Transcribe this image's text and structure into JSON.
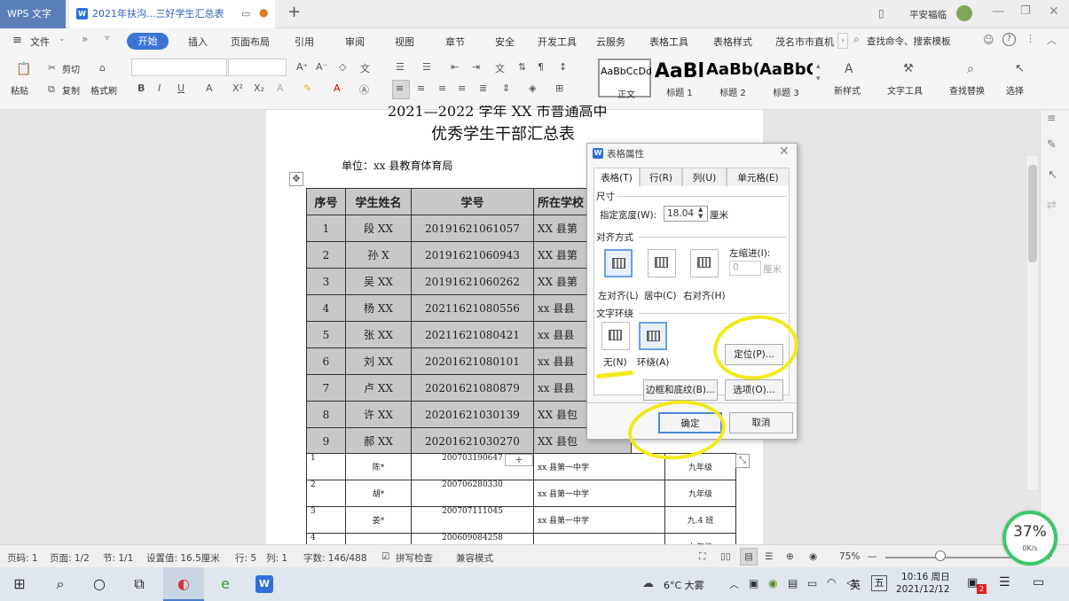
{
  "titlebar": {
    "app_tab": "WPS 文字",
    "doc_tab": "2021年扶沟...三好学生汇总表",
    "user": "平安福临"
  },
  "menubar": {
    "file": "文件",
    "tabs": [
      "开始",
      "插入",
      "页面布局",
      "引用",
      "审阅",
      "视图",
      "章节",
      "安全",
      "开发工具",
      "云服务",
      "表格工具",
      "表格样式",
      "茂名市市直机"
    ],
    "search": "查找命令、搜索模板"
  },
  "ribbon": {
    "paste": "粘贴",
    "cut": "剪切",
    "copy": "复制",
    "format_painter": "格式刷",
    "styles": [
      {
        "sample": "AaBbCcDd",
        "name": "正文"
      },
      {
        "sample": "AaBl",
        "name": "标题 1"
      },
      {
        "sample": "AaBb(",
        "name": "标题 2"
      },
      {
        "sample": "AaBbC",
        "name": "标题 3"
      }
    ],
    "new_style": "新样式",
    "text_tools": "文字工具",
    "find_replace": "查找替换",
    "select": "选择"
  },
  "document": {
    "title_line1": "2021—2022 学年 XX 市普通高中",
    "title_line2": "优秀学生干部汇总表",
    "unit": "单位：xx 县教育体育局",
    "headers": [
      "序号",
      "学生姓名",
      "学号",
      "所在学校"
    ],
    "rows": [
      {
        "no": "1",
        "name": "段 XX",
        "id": "20191621061057",
        "school": "XX 县第"
      },
      {
        "no": "2",
        "name": "孙 X",
        "id": "20191621060943",
        "school": "XX 县第"
      },
      {
        "no": "3",
        "name": "吴 XX",
        "id": "20191621060262",
        "school": "XX 县第"
      },
      {
        "no": "4",
        "name": "杨 XX",
        "id": "20211621080556",
        "school": "xx 县县"
      },
      {
        "no": "5",
        "name": "张 XX",
        "id": "20211621080421",
        "school": "xx 县县"
      },
      {
        "no": "6",
        "name": "刘 XX",
        "id": "20201621080101",
        "school": "xx 县县"
      },
      {
        "no": "7",
        "name": "卢 XX",
        "id": "20201621080879",
        "school": "xx 县县"
      },
      {
        "no": "8",
        "name": "许 XX",
        "id": "20201621030139",
        "school": "XX 县包"
      },
      {
        "no": "9",
        "name": "郝 XX",
        "id": "20201621030270",
        "school": "XX 县包"
      }
    ],
    "rows2": [
      {
        "no": "1",
        "name": "陈*",
        "id": "200703190647",
        "school": "xx 县第一中学",
        "grade": "九年级"
      },
      {
        "no": "2",
        "name": "胡*",
        "id": "200706280330",
        "school": "xx 县第一中学",
        "grade": "九年级"
      },
      {
        "no": "3",
        "name": "姜*",
        "id": "200707111045",
        "school": "xx 县第一中学",
        "grade": "九.4 班"
      },
      {
        "no": "4",
        "name": "",
        "id": "200609084258",
        "school": "",
        "grade": "九年级"
      }
    ]
  },
  "dialog": {
    "title": "表格属性",
    "tabs": [
      "表格(T)",
      "行(R)",
      "列(U)",
      "单元格(E)"
    ],
    "size_section": "尺寸",
    "width_label": "指定宽度(W):",
    "width_value": "18.04",
    "width_unit": "厘米",
    "align_section": "对齐方式",
    "indent_label": "左缩进(I):",
    "indent_value": "0",
    "indent_unit": "厘米",
    "align_left": "左对齐(L)",
    "align_center": "居中(C)",
    "align_right": "右对齐(H)",
    "wrap_section": "文字环绕",
    "wrap_none": "无(N)",
    "wrap_around": "环绕(A)",
    "position_btn": "定位(P)...",
    "borders_btn": "边框和底纹(B)...",
    "options_btn": "选项(O)...",
    "ok": "确定",
    "cancel": "取消"
  },
  "statusbar": {
    "page_no": "页码: 1",
    "pages": "页面: 1/2",
    "section": "节: 1/1",
    "setting": "设置值: 16.5厘米",
    "row": "行: 5",
    "col": "列: 1",
    "words": "字数: 146/488",
    "spell": "拼写检查",
    "compat": "兼容模式",
    "zoom": "75%"
  },
  "taskbar": {
    "weather": "6°C 大雾",
    "ime": "英",
    "ime2": "五",
    "time": "10:16 周日",
    "date": "2021/12/12",
    "badge": "2"
  },
  "widget": {
    "percent": "37%",
    "speed": "0K/s"
  }
}
